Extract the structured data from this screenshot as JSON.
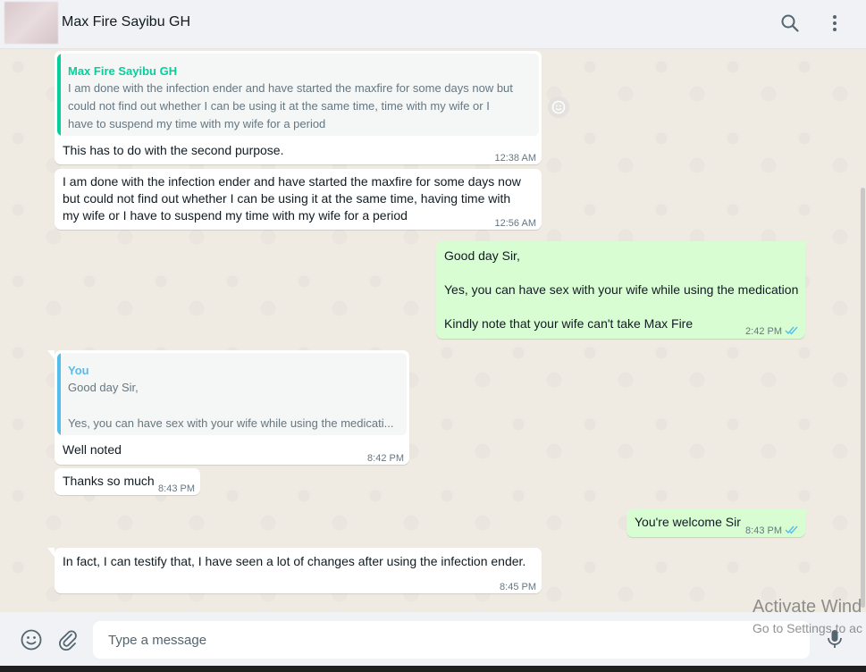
{
  "header": {
    "contact_name": "Max Fire Sayibu GH",
    "search_icon": "search-icon",
    "menu_icon": "kebab-menu-icon"
  },
  "messages": [
    {
      "direction": "incoming",
      "quote_author": "Max Fire Sayibu GH",
      "quote_text": "I am done with the infection ender and have started the maxfire for some days now but\ncould not find out whether I can be using it at the same time, time with my wife or I\nhave to suspend my time with my wife for a period",
      "text": "This has to do with the second purpose.",
      "time": "12:38 AM"
    },
    {
      "direction": "incoming",
      "text": "I am done with the infection ender and have started the maxfire for some days now\nbut could not find out whether I can be using it at the same time, having time with\nmy wife or I have to suspend my time with my wife for a period",
      "time": "12:56 AM"
    },
    {
      "direction": "outgoing",
      "text": "Good day Sir,\n\nYes, you can have sex with your wife while using the medication\n\nKindly note that your wife can't take Max Fire",
      "time": "2:42 PM",
      "status": "read"
    },
    {
      "direction": "incoming",
      "quote_author": "You",
      "quote_text": "Good day Sir,\n\nYes, you can have sex with your wife while using the medicati...",
      "text": "Well noted",
      "time": "8:42 PM"
    },
    {
      "direction": "incoming",
      "text": "Thanks so much",
      "time": "8:43 PM"
    },
    {
      "direction": "outgoing",
      "text": "You're welcome Sir",
      "time": "8:43 PM",
      "status": "read"
    },
    {
      "direction": "incoming",
      "text": "In fact, I can testify that, I have seen a lot of changes after using the infection ender.",
      "time": "8:45 PM"
    }
  ],
  "composer": {
    "placeholder": "Type a message",
    "emoji_icon": "emoji-icon",
    "attach_icon": "paperclip-icon",
    "mic_icon": "microphone-icon"
  },
  "watermark": {
    "line1": "Activate Wind",
    "line2": "Go to Settings to ac"
  },
  "colors": {
    "incoming_bubble": "#ffffff",
    "outgoing_bubble": "#d9fdd3",
    "quote_green": "#06cf9c",
    "quote_blue": "#53bdeb",
    "read_ticks": "#53bdeb"
  }
}
